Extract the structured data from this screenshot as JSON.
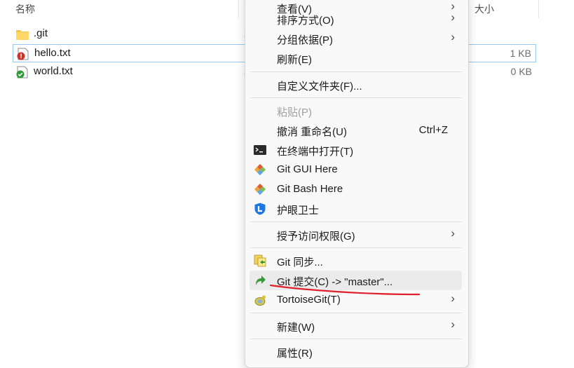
{
  "columns": {
    "name": "名称",
    "size": "大小"
  },
  "files": [
    {
      "name": ".git",
      "size": "",
      "icon": "folder-icon",
      "marker": "2"
    },
    {
      "name": "hello.txt",
      "size": "1 KB",
      "icon": "git-modified-file-icon",
      "marker": "2"
    },
    {
      "name": "world.txt",
      "size": "0 KB",
      "icon": "git-clean-file-icon",
      "marker": "2"
    }
  ],
  "menu": {
    "view": "查看(V)",
    "sort": "排序方式(O)",
    "group": "分组依据(P)",
    "refresh": "刷新(E)",
    "customize": "自定义文件夹(F)...",
    "paste": "粘贴(P)",
    "undo_rename": "撤消 重命名(U)",
    "undo_shortcut": "Ctrl+Z",
    "open_terminal": "在终端中打开(T)",
    "git_gui": "Git GUI Here",
    "git_bash": "Git Bash Here",
    "eye_guard": "护眼卫士",
    "grant_access": "授予访问权限(G)",
    "git_sync": "Git 同步...",
    "git_commit": "Git 提交(C) -> \"master\"...",
    "tortoisegit": "TortoiseGit(T)",
    "new": "新建(W)",
    "properties": "属性(R)"
  },
  "colors": {
    "selection_border": "#99c9ef",
    "hover": "#ebebeb",
    "annotation": "#e0202a"
  }
}
